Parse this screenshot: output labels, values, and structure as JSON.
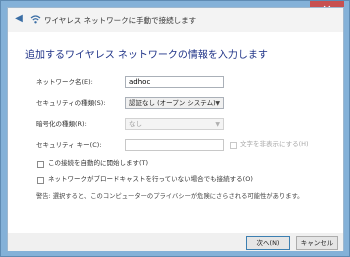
{
  "window": {
    "close_label": "✕"
  },
  "nav": {
    "back_icon": "back-arrow-icon",
    "network_icon": "wifi-icon",
    "title": "ワイヤレス ネットワークに手動で接続します"
  },
  "heading": "追加するワイヤレス ネットワークの情報を入力します",
  "form": {
    "network_name": {
      "label": "ネットワーク名(E):",
      "value": "adhoc"
    },
    "security_type": {
      "label": "セキュリティの種類(S):",
      "value": "認証なし (オープン システム)"
    },
    "encryption_type": {
      "label": "暗号化の種類(R):",
      "value": "なし"
    },
    "security_key": {
      "label": "セキュリティ キー(C):",
      "value": ""
    },
    "hide_chars": {
      "label": "文字を非表示にする(H)"
    }
  },
  "options": {
    "auto_connect": "この接続を自動的に開始します(T)",
    "connect_hidden": "ネットワークがブロードキャストを行っていない場合でも接続する(O)",
    "warning": "警告: 選択すると、このコンピューターのプライバシーが危険にさらされる可能性があります。"
  },
  "footer": {
    "next": "次へ(N)",
    "cancel": "キャンセル"
  },
  "colors": {
    "frame": "#84b1d8",
    "close": "#c75050",
    "heading": "#1e3287",
    "primary_border": "#3c7fb1"
  }
}
